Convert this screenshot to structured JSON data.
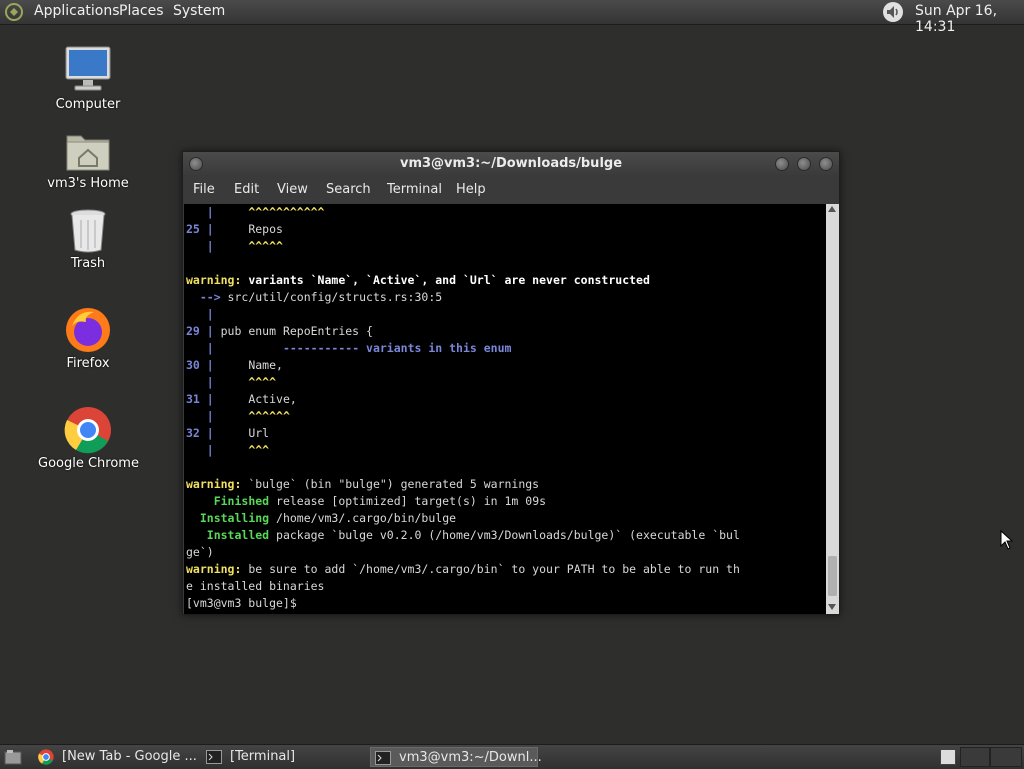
{
  "top_panel": {
    "menus": [
      "Applications",
      "Places",
      "System"
    ],
    "clock": "Sun Apr 16, 14:31",
    "icons": {
      "distro": "distro-logo-icon",
      "volume": "speaker-icon"
    }
  },
  "desktop": {
    "icons": [
      {
        "label": "Computer",
        "icon": "computer-icon"
      },
      {
        "label": "vm3's Home",
        "icon": "home-folder-icon"
      },
      {
        "label": "Trash",
        "icon": "trash-icon"
      },
      {
        "label": "Firefox",
        "icon": "firefox-icon"
      },
      {
        "label": "Google Chrome",
        "icon": "chrome-icon"
      }
    ]
  },
  "window": {
    "title": "vm3@vm3:~/Downloads/bulge",
    "menus": [
      "File",
      "Edit",
      "View",
      "Search",
      "Terminal",
      "Help"
    ]
  },
  "terminal": {
    "lines": [
      "   |     ^^^^^^^^^^^",
      "25 |     Repos",
      "   |     ^^^^^",
      "",
      "warning: variants `Name`, `Active`, and `Url` are never constructed",
      "  --> src/util/config/structs.rs:30:5",
      "   |",
      "29 | pub enum RepoEntries {",
      "   |          ----------- variants in this enum",
      "30 |     Name,",
      "   |     ^^^^",
      "31 |     Active,",
      "   |     ^^^^^^",
      "32 |     Url",
      "   |     ^^^",
      "",
      "warning: `bulge` (bin \"bulge\") generated 5 warnings",
      "    Finished release [optimized] target(s) in 1m 09s",
      "  Installing /home/vm3/.cargo/bin/bulge",
      "   Installed package `bulge v0.2.0 (/home/vm3/Downloads/bulge)` (executable `bul",
      "ge`)",
      "warning: be sure to add `/home/vm3/.cargo/bin` to your PATH to be able to run th",
      "e installed binaries",
      "[vm3@vm3 bulge]$ "
    ]
  },
  "taskbar": {
    "tasks": [
      {
        "label": "[New Tab - Google ...",
        "icon": "chrome-icon"
      },
      {
        "label": "[Terminal]",
        "icon": "terminal-icon"
      },
      {
        "label": "vm3@vm3:~/Downl...",
        "icon": "terminal-icon"
      }
    ],
    "icons": {
      "show_desktop": "show-desktop-icon"
    }
  },
  "colors": {
    "warning": "#f0e060",
    "gutter": "#7a86d8",
    "status_green": "#58d858",
    "terminal_bg": "#000000"
  }
}
